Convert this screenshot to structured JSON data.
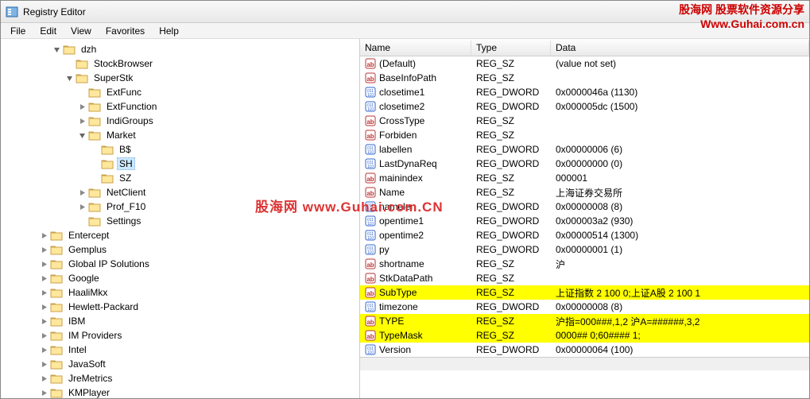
{
  "window": {
    "title": "Registry Editor"
  },
  "menu": [
    "File",
    "Edit",
    "View",
    "Favorites",
    "Help"
  ],
  "watermark": {
    "line1": "股海网 股票软件资源分享",
    "line2": "Www.Guhai.com.cn",
    "center": "股海网 www.Guhai.com.CN"
  },
  "tree": [
    {
      "depth": 4,
      "label": "dzh",
      "exp": "open"
    },
    {
      "depth": 5,
      "label": "StockBrowser",
      "exp": "none"
    },
    {
      "depth": 5,
      "label": "SuperStk",
      "exp": "open"
    },
    {
      "depth": 6,
      "label": "ExtFunc",
      "exp": "none"
    },
    {
      "depth": 6,
      "label": "ExtFunction",
      "exp": "closed"
    },
    {
      "depth": 6,
      "label": "IndiGroups",
      "exp": "closed"
    },
    {
      "depth": 6,
      "label": "Market",
      "exp": "open"
    },
    {
      "depth": 7,
      "label": "B$",
      "exp": "none"
    },
    {
      "depth": 7,
      "label": "SH",
      "exp": "none",
      "selected": true
    },
    {
      "depth": 7,
      "label": "SZ",
      "exp": "none"
    },
    {
      "depth": 6,
      "label": "NetClient",
      "exp": "closed"
    },
    {
      "depth": 6,
      "label": "Prof_F10",
      "exp": "closed"
    },
    {
      "depth": 6,
      "label": "Settings",
      "exp": "none"
    },
    {
      "depth": 3,
      "label": "Entercept",
      "exp": "closed"
    },
    {
      "depth": 3,
      "label": "Gemplus",
      "exp": "closed"
    },
    {
      "depth": 3,
      "label": "Global IP Solutions",
      "exp": "closed"
    },
    {
      "depth": 3,
      "label": "Google",
      "exp": "closed"
    },
    {
      "depth": 3,
      "label": "HaaliMkx",
      "exp": "closed"
    },
    {
      "depth": 3,
      "label": "Hewlett-Packard",
      "exp": "closed"
    },
    {
      "depth": 3,
      "label": "IBM",
      "exp": "closed"
    },
    {
      "depth": 3,
      "label": "IM Providers",
      "exp": "closed"
    },
    {
      "depth": 3,
      "label": "Intel",
      "exp": "closed"
    },
    {
      "depth": 3,
      "label": "JavaSoft",
      "exp": "closed"
    },
    {
      "depth": 3,
      "label": "JreMetrics",
      "exp": "closed"
    },
    {
      "depth": 3,
      "label": "KMPlayer",
      "exp": "closed"
    }
  ],
  "columns": {
    "name": "Name",
    "type": "Type",
    "data": "Data"
  },
  "values": [
    {
      "icon": "sz",
      "name": "(Default)",
      "type": "REG_SZ",
      "data": "(value not set)"
    },
    {
      "icon": "sz",
      "name": "BaseInfoPath",
      "type": "REG_SZ",
      "data": ""
    },
    {
      "icon": "bin",
      "name": "closetime1",
      "type": "REG_DWORD",
      "data": "0x0000046a (1130)"
    },
    {
      "icon": "bin",
      "name": "closetime2",
      "type": "REG_DWORD",
      "data": "0x000005dc (1500)"
    },
    {
      "icon": "sz",
      "name": "CrossType",
      "type": "REG_SZ",
      "data": ""
    },
    {
      "icon": "sz",
      "name": "Forbiden",
      "type": "REG_SZ",
      "data": ""
    },
    {
      "icon": "bin",
      "name": "labellen",
      "type": "REG_DWORD",
      "data": "0x00000006 (6)"
    },
    {
      "icon": "bin",
      "name": "LastDynaReq",
      "type": "REG_DWORD",
      "data": "0x00000000 (0)"
    },
    {
      "icon": "sz",
      "name": "mainindex",
      "type": "REG_SZ",
      "data": "000001"
    },
    {
      "icon": "sz",
      "name": "Name",
      "type": "REG_SZ",
      "data": "上海证券交易所"
    },
    {
      "icon": "bin",
      "name": "namelen",
      "type": "REG_DWORD",
      "data": "0x00000008 (8)"
    },
    {
      "icon": "bin",
      "name": "opentime1",
      "type": "REG_DWORD",
      "data": "0x000003a2 (930)"
    },
    {
      "icon": "bin",
      "name": "opentime2",
      "type": "REG_DWORD",
      "data": "0x00000514 (1300)"
    },
    {
      "icon": "bin",
      "name": "py",
      "type": "REG_DWORD",
      "data": "0x00000001 (1)"
    },
    {
      "icon": "sz",
      "name": "shortname",
      "type": "REG_SZ",
      "data": "沪"
    },
    {
      "icon": "sz",
      "name": "StkDataPath",
      "type": "REG_SZ",
      "data": ""
    },
    {
      "icon": "sz",
      "name": "SubType",
      "type": "REG_SZ",
      "data": "上证指数 2 100 0;上证A股 2 100 1",
      "hl": true
    },
    {
      "icon": "bin",
      "name": "timezone",
      "type": "REG_DWORD",
      "data": "0x00000008 (8)"
    },
    {
      "icon": "sz",
      "name": "TYPE",
      "type": "REG_SZ",
      "data": "沪指=000###,1,2 沪A=######,3,2",
      "hl": true
    },
    {
      "icon": "sz",
      "name": "TypeMask",
      "type": "REG_SZ",
      "data": "0000## 0;60#### 1;",
      "hl": true
    },
    {
      "icon": "bin",
      "name": "Version",
      "type": "REG_DWORD",
      "data": "0x00000064 (100)"
    }
  ]
}
